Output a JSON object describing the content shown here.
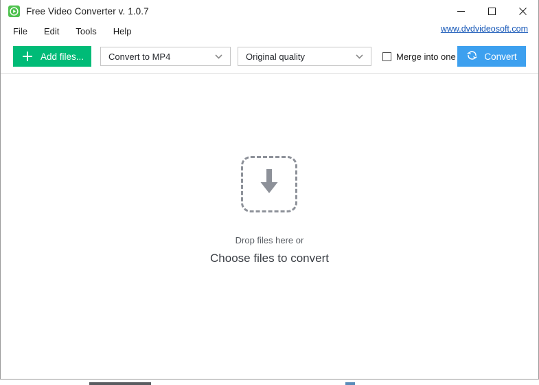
{
  "window": {
    "title": "Free Video Converter v. 1.0.7",
    "app_icon": "play-circle-icon",
    "controls": {
      "minimize": "minimize-icon",
      "maximize": "maximize-icon",
      "close": "close-icon"
    }
  },
  "menu": {
    "items": [
      {
        "label": "File"
      },
      {
        "label": "Edit"
      },
      {
        "label": "Tools"
      },
      {
        "label": "Help"
      }
    ],
    "site_link": "www.dvdvideosoft.com"
  },
  "toolbar": {
    "add_files_label": "Add files...",
    "add_files_icon": "plus-icon",
    "format_select": {
      "value": "Convert to MP4",
      "chevron": "chevron-down-icon"
    },
    "quality_select": {
      "value": "Original quality",
      "chevron": "chevron-down-icon"
    },
    "merge_checkbox": {
      "label": "Merge into one file",
      "checked": false
    },
    "convert_label": "Convert",
    "convert_icon": "refresh-circular-arrows-icon"
  },
  "drop_zone": {
    "icon": "download-arrow-icon",
    "hint": "Drop files here or",
    "action": "Choose files to convert"
  },
  "colors": {
    "add_files_green": "#00bb77",
    "convert_blue": "#3da0ef",
    "link_blue": "#1758b8",
    "app_icon_green": "#4fc24f",
    "drop_gray": "#8d9199"
  }
}
